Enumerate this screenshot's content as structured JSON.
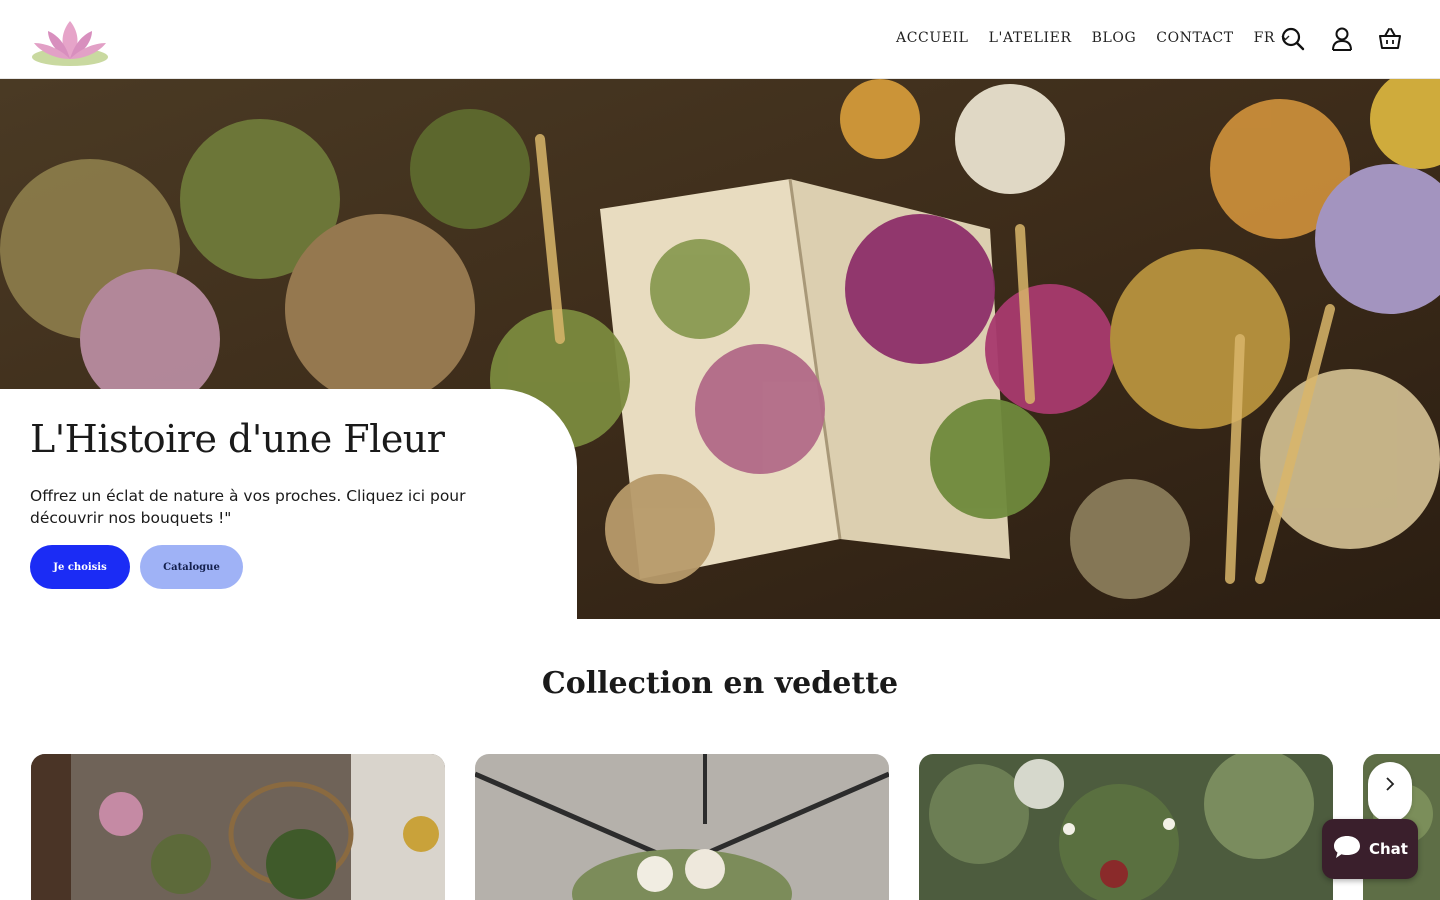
{
  "header": {
    "logo_icon": "lotus-logo",
    "nav": [
      {
        "label": "ACCUEIL"
      },
      {
        "label": "L'ATELIER"
      },
      {
        "label": "BLOG"
      },
      {
        "label": "CONTACT"
      }
    ],
    "language": "FR",
    "icons": [
      "search-icon",
      "account-icon",
      "cart-icon"
    ]
  },
  "hero": {
    "title": "L'Histoire d'une Fleur",
    "subtitle": "Offrez un éclat de nature à vos proches. Cliquez ici pour découvrir nos bouquets !\"",
    "primary_button": "Je choisis",
    "secondary_button": "Catalogue"
  },
  "featured": {
    "title": "Collection en vedette"
  },
  "chat": {
    "label": "Chat"
  },
  "colors": {
    "primary_button": "#1b2cf5",
    "secondary_button": "#9fb2f6",
    "chat_widget": "#3a1f2c"
  }
}
